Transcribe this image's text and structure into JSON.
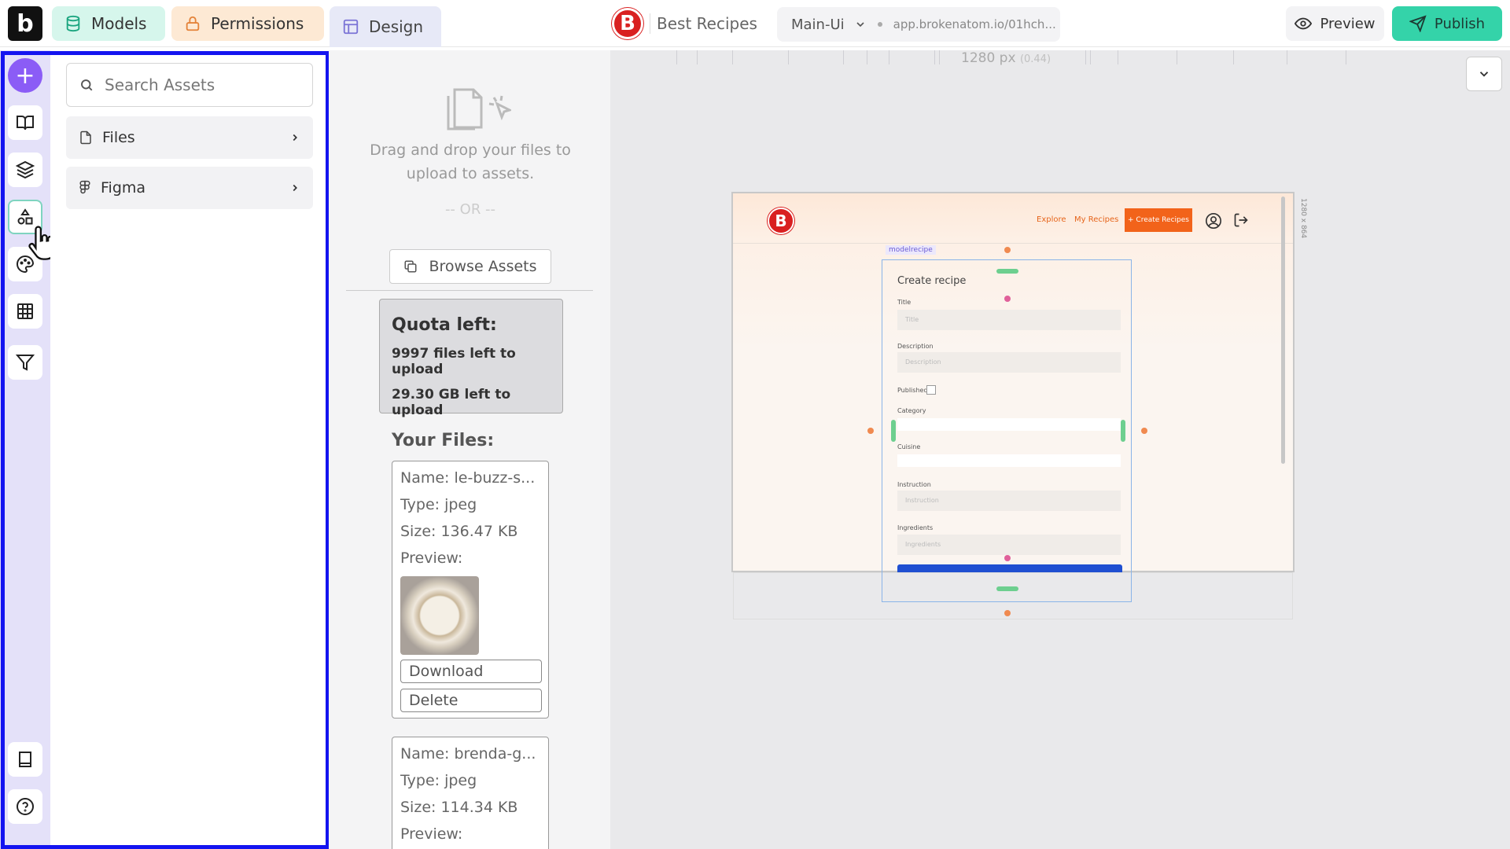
{
  "topbar": {
    "logo_letter": "b",
    "tabs": [
      {
        "label": "Models",
        "color": "#d6f6ec"
      },
      {
        "label": "Permissions",
        "color": "#fde9d4"
      },
      {
        "label": "Design",
        "color": "#e7e9f7"
      }
    ],
    "project_logo_letter": "B",
    "project_name": "Best Recipes",
    "environment": "Main-Ui",
    "url": "app.brokenatom.io/01hch...",
    "preview_label": "Preview",
    "publish_label": "Publish",
    "publish_color": "#34d3a9"
  },
  "rail": {
    "icons": [
      "plus-icon",
      "book-open-icon",
      "layers-icon",
      "shapes-icon",
      "palette-icon",
      "table-icon",
      "filter-icon",
      "book-icon",
      "help-icon"
    ],
    "add_label": "+",
    "accent": "#8b5cf6"
  },
  "assets_panel": {
    "search_placeholder": "Search Assets",
    "items": [
      {
        "label": "Files",
        "icon": "file-icon"
      },
      {
        "label": "Figma",
        "icon": "figma-icon"
      }
    ]
  },
  "upload": {
    "drop_text": "Drag and drop your files to upload to assets.",
    "or_text": "-- OR --",
    "browse_label": "Browse Assets",
    "quota_title": "Quota left:",
    "quota_files": "9997 files left to upload",
    "quota_storage": "29.30 GB left to upload",
    "files_heading": "Your Files:",
    "files": [
      {
        "name": "Name: le-buzz-s...",
        "type": "Type: jpeg",
        "size": "Size: 136.47 KB",
        "preview": "Preview:",
        "download": "Download",
        "delete": "Delete"
      },
      {
        "name": "Name: brenda-g...",
        "type": "Type: jpeg",
        "size": "Size: 114.34 KB",
        "preview": "Preview:"
      }
    ]
  },
  "canvas": {
    "ruler_width": "1280 px",
    "ruler_zoom": "(0.44)",
    "frame_size": "1280 x 864",
    "nav": {
      "logo_letter": "B",
      "explore": "Explore",
      "my_recipes": "My Recipes",
      "create_button": "+ Create Recipes",
      "accent": "#f2631a"
    },
    "form": {
      "tag": "modelrecipe",
      "title": "Create recipe",
      "fields": {
        "title_label": "Title",
        "title_placeholder": "Title",
        "description_label": "Description",
        "description_placeholder": "Description",
        "published_label": "Published",
        "category_label": "Category",
        "cuisine_label": "Cuisine",
        "instruction_label": "Instruction",
        "instruction_placeholder": "Instruction",
        "ingredients_label": "Ingredients",
        "ingredients_placeholder": "Ingredients"
      }
    }
  }
}
